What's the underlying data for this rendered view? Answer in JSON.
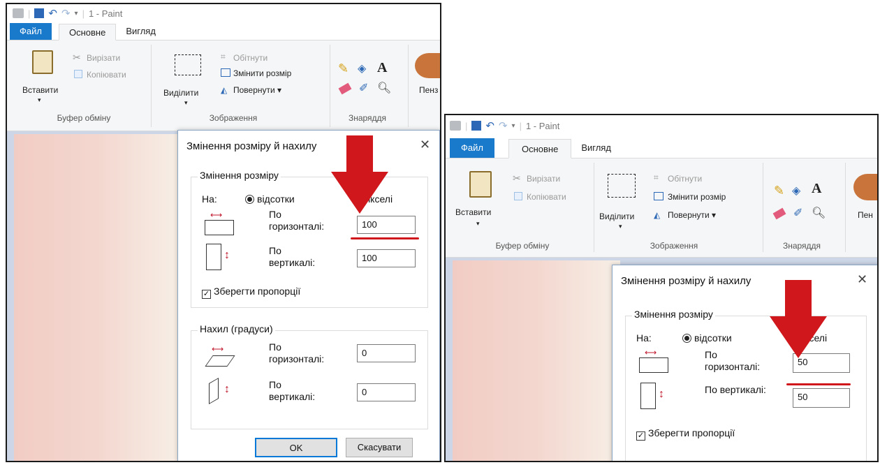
{
  "left": {
    "title": "1 - Paint",
    "tabs": {
      "file": "Файл",
      "home": "Основне",
      "view": "Вигляд"
    },
    "ribbon": {
      "paste": "Вставити",
      "cut": "Вирізати",
      "copy": "Копіювати",
      "clipboard": "Буфер обміну",
      "select": "Виділити",
      "crop": "Обітнути",
      "resize": "Змінити розмір",
      "rotate": "Повернути ▾",
      "image": "Зображення",
      "tools": "Знаряддя",
      "brushes": "Пенз"
    },
    "dialog": {
      "title": "Змінення розміру й нахилу",
      "resize_legend": "Змінення розміру",
      "by_label": "На:",
      "percent_option": "відсотки",
      "pixels_option": "Пікселі",
      "horizontal_label": "По горизонталі:",
      "vertical_label": "По вертикалі:",
      "resize_h": "100",
      "resize_v": "100",
      "keep_ratio": "Зберегти пропорції",
      "skew_legend": "Нахил (градуси)",
      "skew_h": "0",
      "skew_v": "0",
      "ok": "OK",
      "cancel": "Скасувати"
    }
  },
  "right": {
    "title": "1 - Paint",
    "tabs": {
      "file": "Файл",
      "home": "Основне",
      "view": "Вигляд"
    },
    "ribbon": {
      "paste": "Вставити",
      "cut": "Вирізати",
      "copy": "Копіювати",
      "clipboard": "Буфер обміну",
      "select": "Виділити",
      "crop": "Обітнути",
      "resize": "Змінити розмір",
      "rotate": "Повернути ▾",
      "image": "Зображення",
      "tools": "Знаряддя",
      "brushes": "Пен"
    },
    "dialog": {
      "title": "Змінення розміру й нахилу",
      "resize_legend": "Змінення розміру",
      "by_label": "На:",
      "percent_option": "відсотки",
      "pixels_option": "Пікселі",
      "horizontal_label": "По горизонталі:",
      "vertical_label": "По вертикалі:",
      "resize_h": "50",
      "resize_v": "50",
      "keep_ratio": "Зберегти пропорції"
    }
  },
  "colors": {
    "file_tab": "#1979ca",
    "highlight": "#d0171c"
  }
}
